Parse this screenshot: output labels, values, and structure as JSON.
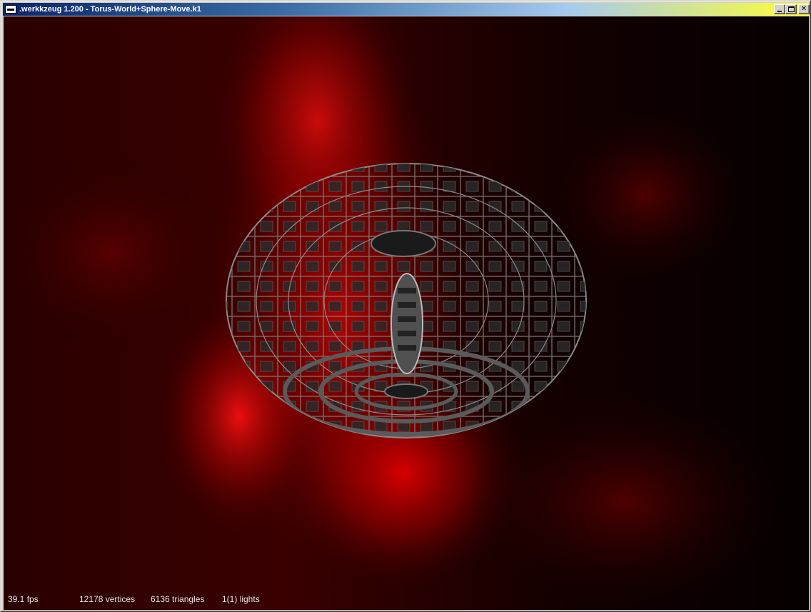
{
  "window": {
    "title": ".werkkzeug 1.200 - Torus-World+Sphere-Move.k1",
    "app_icon": "console-window-icon",
    "close_glyph": "✕"
  },
  "scene": {
    "description_colors": {
      "background_dark": "#050000",
      "nebula_red": "#c00000",
      "mesh_gray": "#8a8a8a"
    }
  },
  "status": {
    "fps": "39.1 fps",
    "vertices": "12178 vertices",
    "triangles": "6136 triangles",
    "lights": "1(1) lights"
  }
}
